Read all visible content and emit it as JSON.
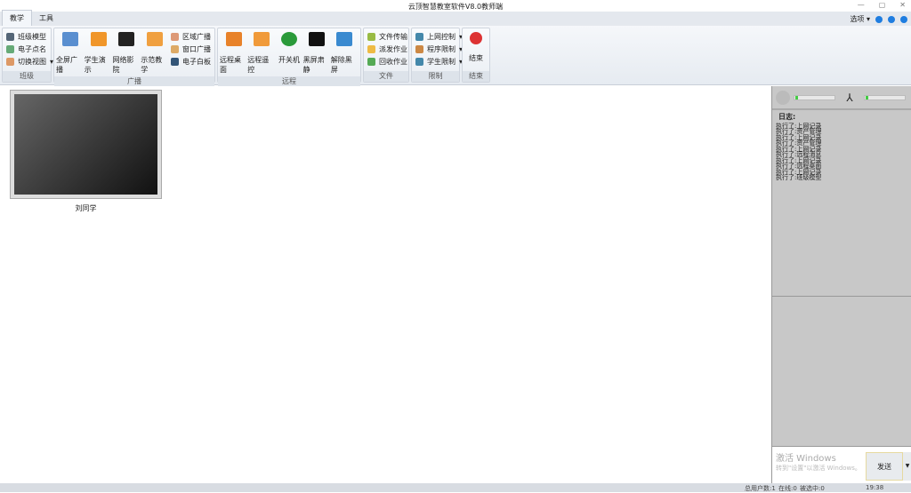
{
  "window": {
    "title": "云顶智慧教室软件V8.0教师端",
    "min": "—",
    "max": "▢",
    "close": "✕"
  },
  "tabs": [
    {
      "label": "教学",
      "active": true
    },
    {
      "label": "工具",
      "active": false
    }
  ],
  "options_label": "选项",
  "groups": {
    "class": {
      "label": "班级",
      "items": [
        "班级模型",
        "电子点名",
        "切换视图"
      ]
    },
    "broadcast": {
      "label": "广播",
      "big": [
        "全屏广播",
        "学生演示",
        "网络影院",
        "示范教学"
      ],
      "small": [
        "区域广播",
        "窗口广播",
        "电子白板"
      ]
    },
    "remote": {
      "label": "远程",
      "big": [
        "远程桌面",
        "远程遥控",
        "开关机",
        "黑屏肃静",
        "解除黑屏"
      ]
    },
    "file": {
      "label": "文件",
      "items": [
        "文件传输",
        "派发作业",
        "回收作业"
      ]
    },
    "limit": {
      "label": "限制",
      "items": [
        "上网控制",
        "程序限制",
        "学生限制"
      ]
    },
    "end": {
      "label": "结束",
      "button": "结束"
    }
  },
  "students": [
    {
      "name": "刘同学"
    }
  ],
  "log": {
    "title": "日志:",
    "entries": [
      "执行了:上网记录",
      "执行了:资产管理",
      "执行了:上网记录",
      "执行了:资产管理",
      "执行了:上网记录",
      "执行了:远程消息",
      "执行了:上网记录",
      "执行了:远程桌面",
      "执行了:上网记录",
      "执行了:班级模型"
    ]
  },
  "chat": {
    "watermark1": "激活 Windows",
    "watermark2": "转到\"设置\"以激活 Windows。",
    "send": "发送"
  },
  "status": {
    "total": "总用户数:1",
    "online": "在线:0",
    "selected": "被选中:0",
    "time": "19:38"
  },
  "colors": {
    "accent": "#1f7de0",
    "ribbon": "#e6ebf1"
  }
}
